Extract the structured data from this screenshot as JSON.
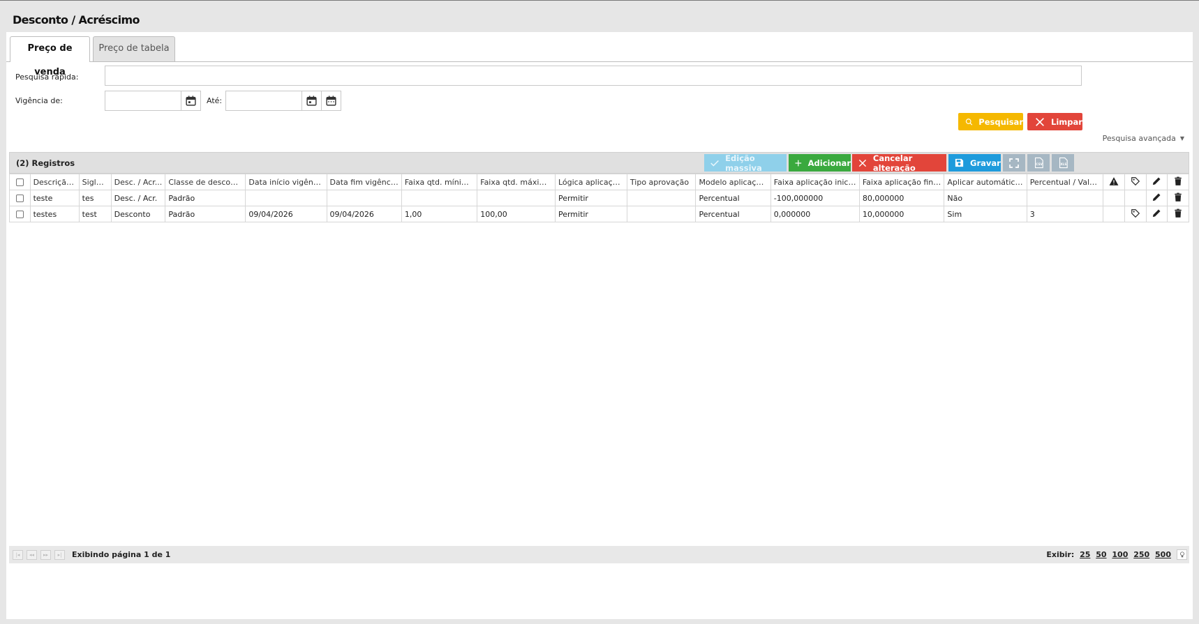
{
  "page": {
    "title": "Desconto / Acréscimo"
  },
  "tabs": [
    {
      "label": "Preço de venda",
      "active": true
    },
    {
      "label": "Preço de tabela",
      "active": false
    }
  ],
  "filters": {
    "quick_search_label": "Pesquisa rápida:",
    "quick_search_value": "",
    "vigencia_label": "Vigência de:",
    "vigencia_value": "",
    "ate_label": "Até:",
    "ate_value": "",
    "search_button": "Pesquisar",
    "clear_button": "Limpar",
    "advanced_search": "Pesquisa avançada"
  },
  "grid": {
    "title": "(2) Registros",
    "buttons": {
      "mass_edit": "Edição massiva",
      "add": "Adicionar",
      "cancel": "Cancelar alteração",
      "save": "Gravar"
    },
    "columns": [
      "Descrição...",
      "Sigla...",
      "Desc. / Acr...",
      "Classe de desconto...",
      "Data início vigência...",
      "Data fim vigência...",
      "Faixa qtd. mínima...",
      "Faixa qtd. máxima...",
      "Lógica aplicação...",
      "Tipo aprovação",
      "Modelo aplicação...",
      "Faixa aplicação inicial...",
      "Faixa aplicação final...",
      "Aplicar automático?...",
      "Percentual / Valor..."
    ],
    "rows": [
      [
        "teste",
        "tes",
        "Desc. / Acr.",
        "Padrão",
        "",
        "",
        "",
        "",
        "Permitir",
        "",
        "Percentual",
        "-100,000000",
        "80,000000",
        "Não",
        ""
      ],
      [
        "testes",
        "test",
        "Desconto",
        "Padrão",
        "09/04/2026",
        "09/04/2026",
        "1,00",
        "100,00",
        "Permitir",
        "",
        "Percentual",
        "0,000000",
        "10,000000",
        "Sim",
        "3"
      ]
    ]
  },
  "pagination": {
    "info": "Exibindo página 1 de 1",
    "show_label": "Exibir:",
    "sizes": [
      "25",
      "50",
      "100",
      "250",
      "500"
    ]
  },
  "colors": {
    "yellow": "#f5b800",
    "red": "#e2453a",
    "green": "#3aa93e",
    "blue": "#1e9bdc",
    "disabled": "#8fd0ea"
  }
}
